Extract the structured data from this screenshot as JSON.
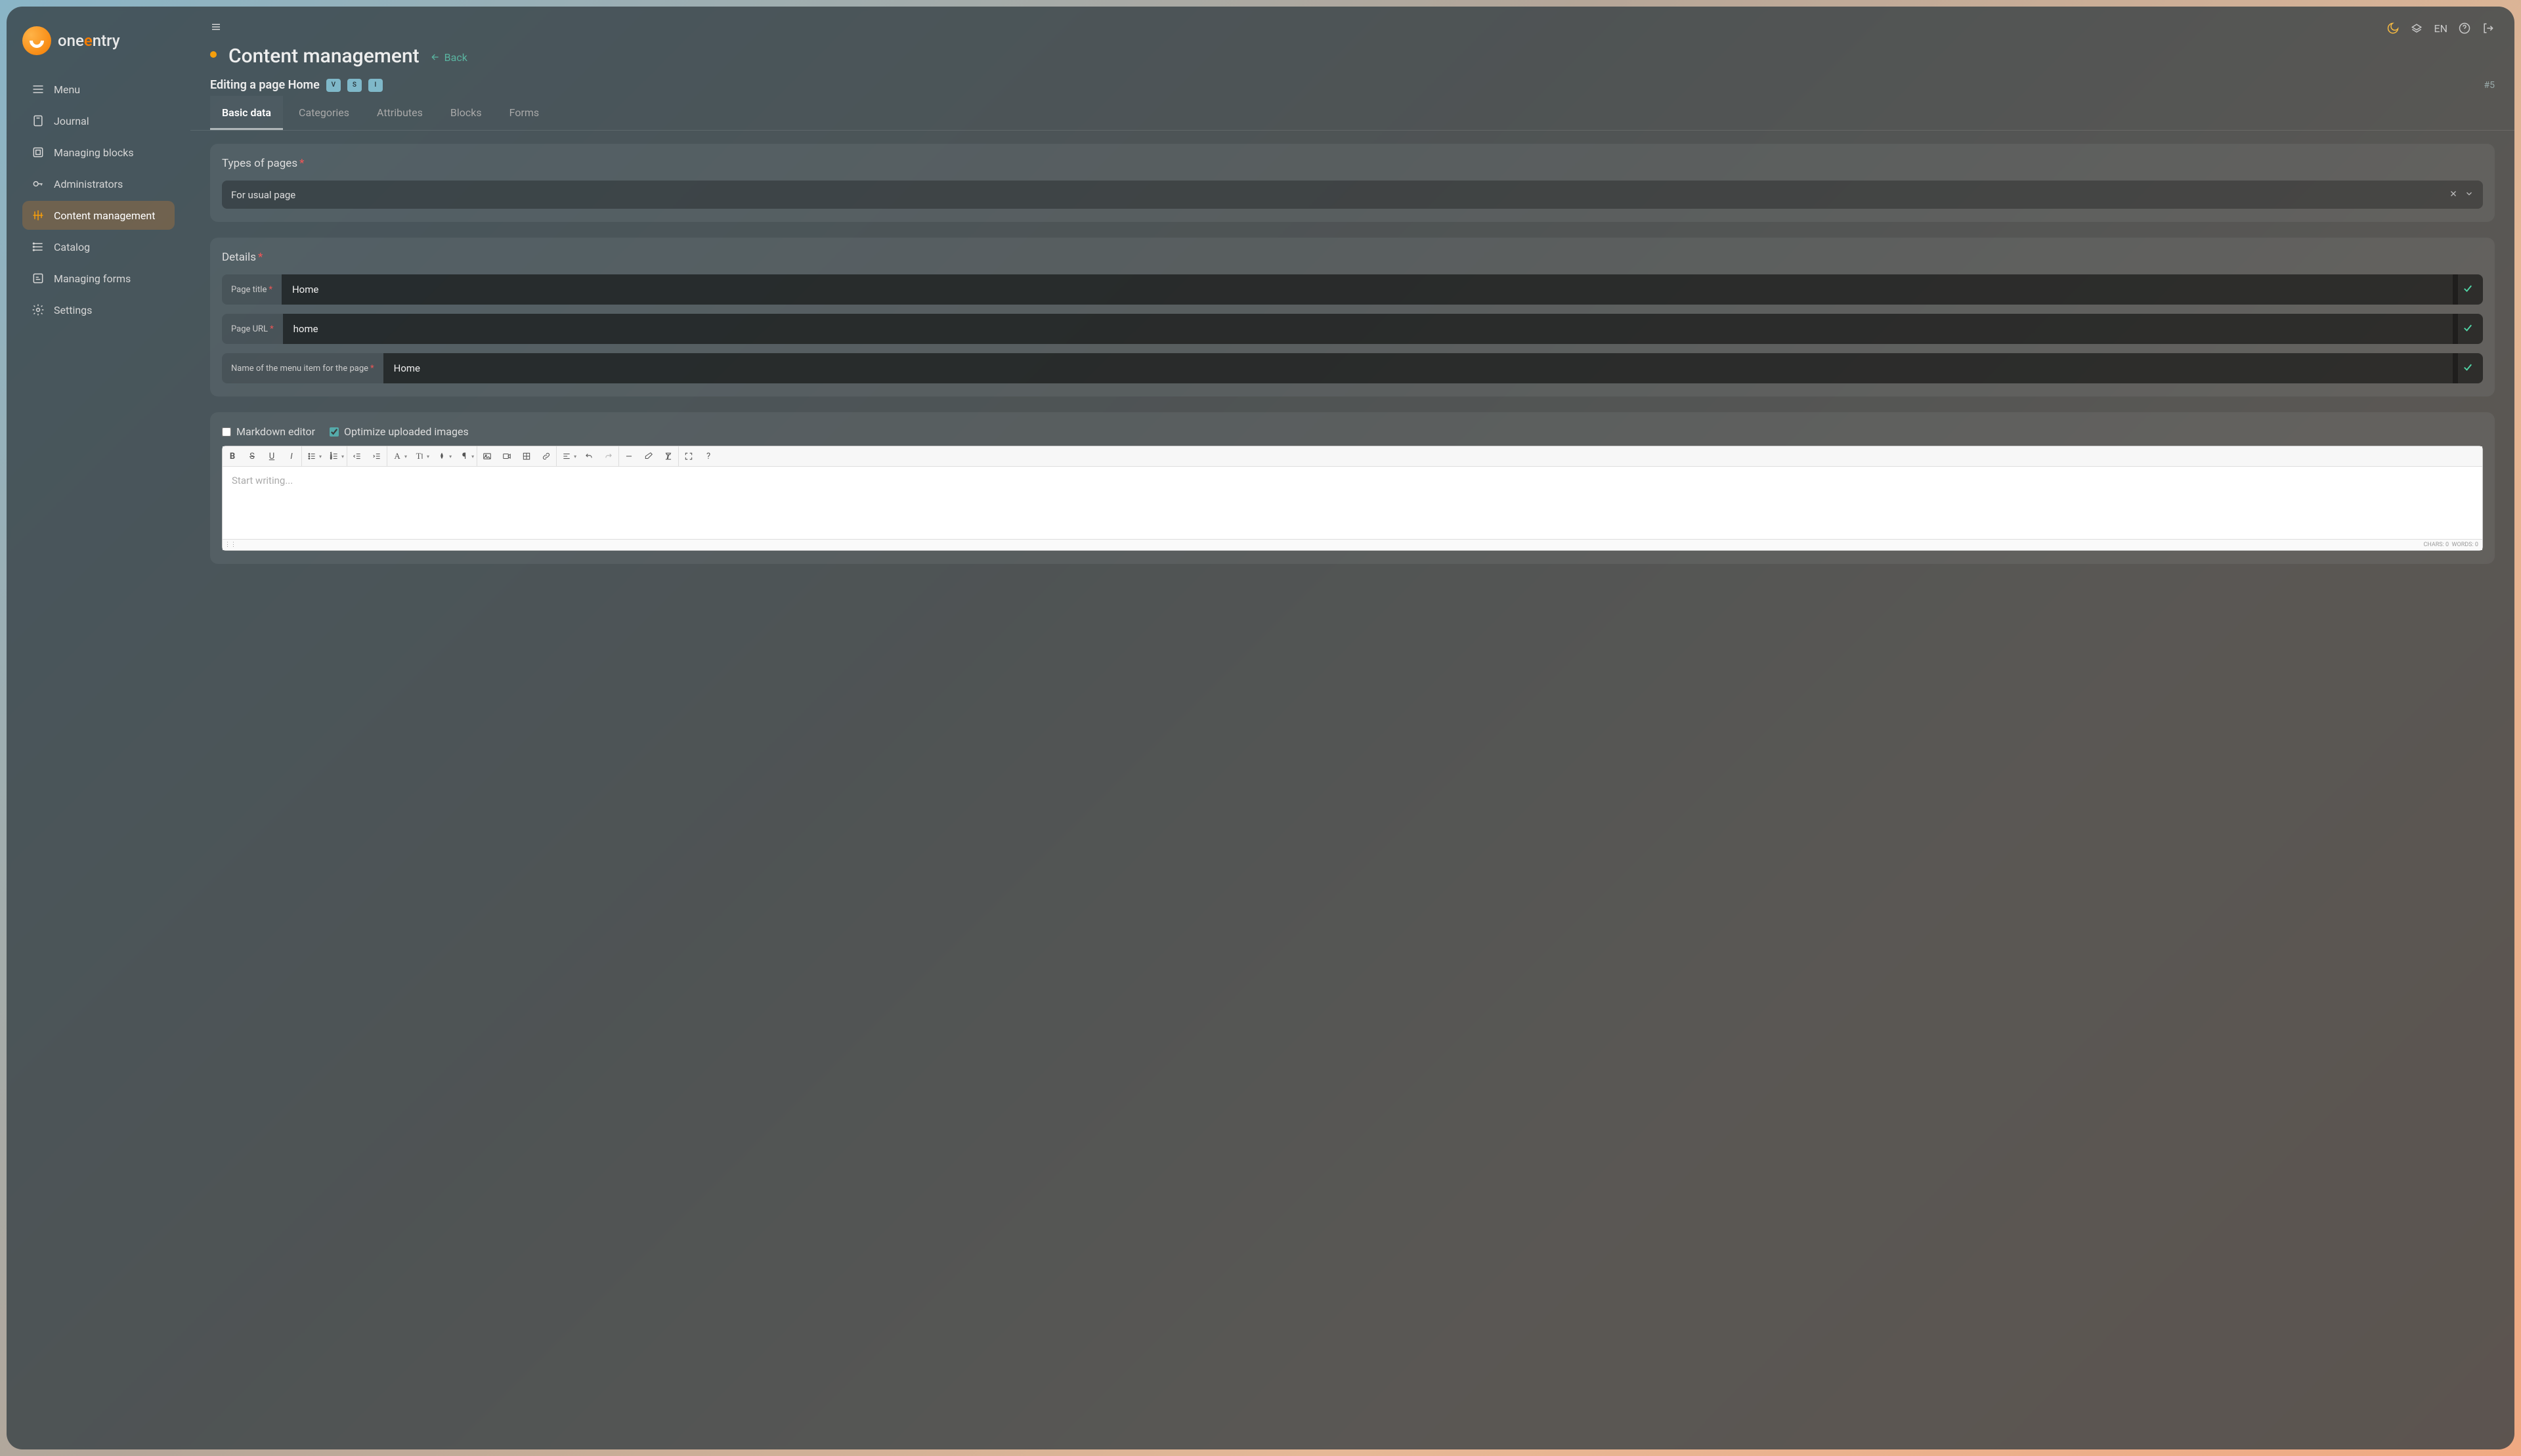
{
  "brand": {
    "name_prefix": "one",
    "name_accent": "e",
    "name_suffix": "ntry"
  },
  "topbar": {
    "lang": "EN"
  },
  "sidebar": {
    "items": [
      {
        "label": "Menu"
      },
      {
        "label": "Journal"
      },
      {
        "label": "Managing blocks"
      },
      {
        "label": "Administrators"
      },
      {
        "label": "Content management"
      },
      {
        "label": "Catalog"
      },
      {
        "label": "Managing forms"
      },
      {
        "label": "Settings"
      }
    ]
  },
  "header": {
    "title": "Content management",
    "back": "Back",
    "subtitle": "Editing a page Home",
    "lang_tags": [
      "V",
      "S",
      "I"
    ],
    "page_id": "#5"
  },
  "tabs": [
    "Basic data",
    "Categories",
    "Attributes",
    "Blocks",
    "Forms"
  ],
  "types_panel": {
    "title": "Types of pages",
    "value": "For usual page"
  },
  "details_panel": {
    "title": "Details",
    "page_title_label": "Page title",
    "page_title_value": "Home",
    "page_url_label": "Page URL",
    "page_url_value": "home",
    "menu_name_label": "Name of the menu item for the page",
    "menu_name_value": "Home"
  },
  "editor": {
    "markdown_label": "Markdown editor",
    "optimize_label": "Optimize uploaded images",
    "placeholder": "Start writing...",
    "chars_label": "CHARS: 0",
    "words_label": "WORDS: 0"
  }
}
